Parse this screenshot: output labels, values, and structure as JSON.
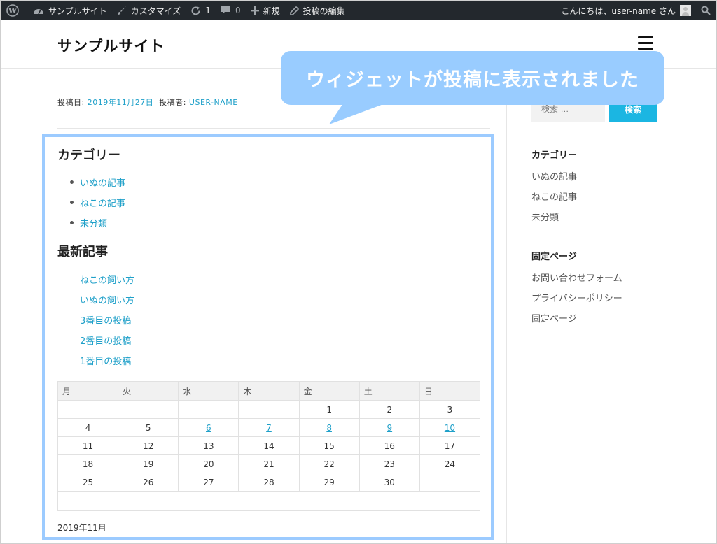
{
  "adminbar": {
    "site_name": "サンプルサイト",
    "customize": "カスタマイズ",
    "updates_count": "1",
    "comments_count": "0",
    "new_label": "新規",
    "edit_label": "投稿の編集",
    "greeting": "こんにちは、user-name さん"
  },
  "header": {
    "site_title": "サンプルサイト"
  },
  "callout": {
    "text": "ウィジェットが投稿に表示されました",
    "color": "#99ccff"
  },
  "post_meta": {
    "date_label": "投稿日: ",
    "date": "2019年11月27日",
    "author_label": "投稿者: ",
    "author": "USER-NAME"
  },
  "widgets": {
    "categories_title": "カテゴリー",
    "categories": [
      "いぬの記事",
      "ねこの記事",
      "未分類"
    ],
    "recent_title": "最新記事",
    "recent_posts": [
      "ねこの飼い方",
      "いぬの飼い方",
      "3番目の投稿",
      "2番目の投稿",
      "1番目の投稿"
    ]
  },
  "calendar": {
    "weekdays": [
      "月",
      "火",
      "水",
      "木",
      "金",
      "土",
      "日"
    ],
    "rows": [
      [
        "",
        "",
        "",
        "",
        "1",
        "2",
        "3"
      ],
      [
        "4",
        "5",
        "6",
        "7",
        "8",
        "9",
        "10"
      ],
      [
        "11",
        "12",
        "13",
        "14",
        "15",
        "16",
        "17"
      ],
      [
        "18",
        "19",
        "20",
        "21",
        "22",
        "23",
        "24"
      ],
      [
        "25",
        "26",
        "27",
        "28",
        "29",
        "30",
        ""
      ]
    ],
    "linked_days": [
      "6",
      "7",
      "8",
      "9",
      "10"
    ],
    "caption": "2019年11月"
  },
  "sidebar": {
    "search_placeholder": "検索 …",
    "search_button": "検索",
    "categories_title": "カテゴリー",
    "categories": [
      "いぬの記事",
      "ねこの記事",
      "未分類"
    ],
    "pages_title": "固定ページ",
    "pages": [
      "お問い合わせフォーム",
      "プライバシーポリシー",
      "固定ページ"
    ]
  },
  "colors": {
    "accent_link": "#1fa0c9",
    "search_button": "#1bb6e2",
    "adminbar_bg": "#23282d",
    "highlight_border": "#9ccbff"
  }
}
